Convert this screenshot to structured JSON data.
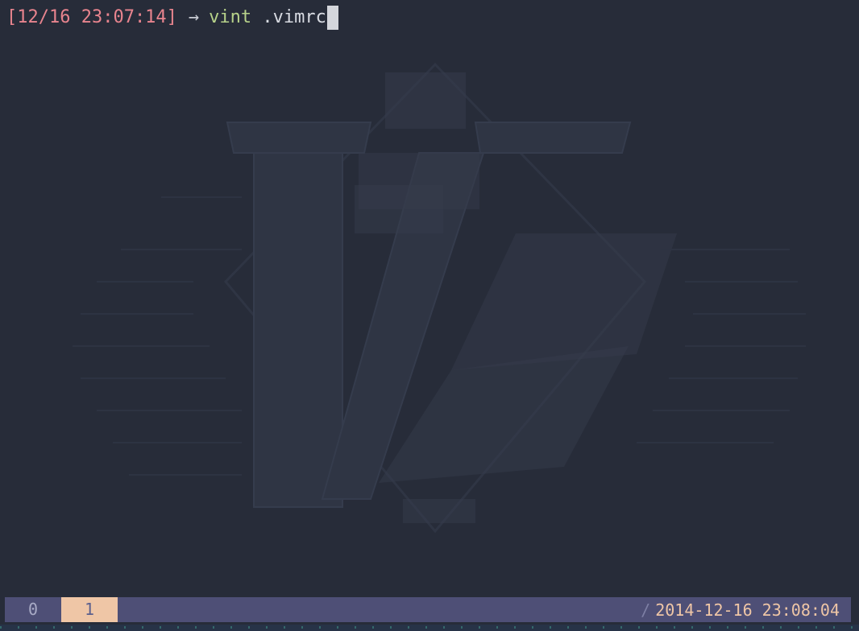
{
  "terminal": {
    "prompt": {
      "timestamp": "[12/16 23:07:14]",
      "arrow": "→",
      "command": "vint",
      "argument": " .vimrc"
    },
    "cursor_icon": "block-cursor-icon"
  },
  "background_art": {
    "icon": "vim-logo-icon"
  },
  "status_bar": {
    "windows": [
      {
        "label": "0"
      },
      {
        "label": "1"
      }
    ],
    "active_window": "1",
    "divider": "/",
    "clock": "2014-12-16 23:08:04"
  },
  "colors": {
    "background": "#272c39",
    "timestamp": "#e8848e",
    "command": "#b7d28a",
    "status_bar": "#4e4f76",
    "active_tab": "#efc6a6"
  }
}
